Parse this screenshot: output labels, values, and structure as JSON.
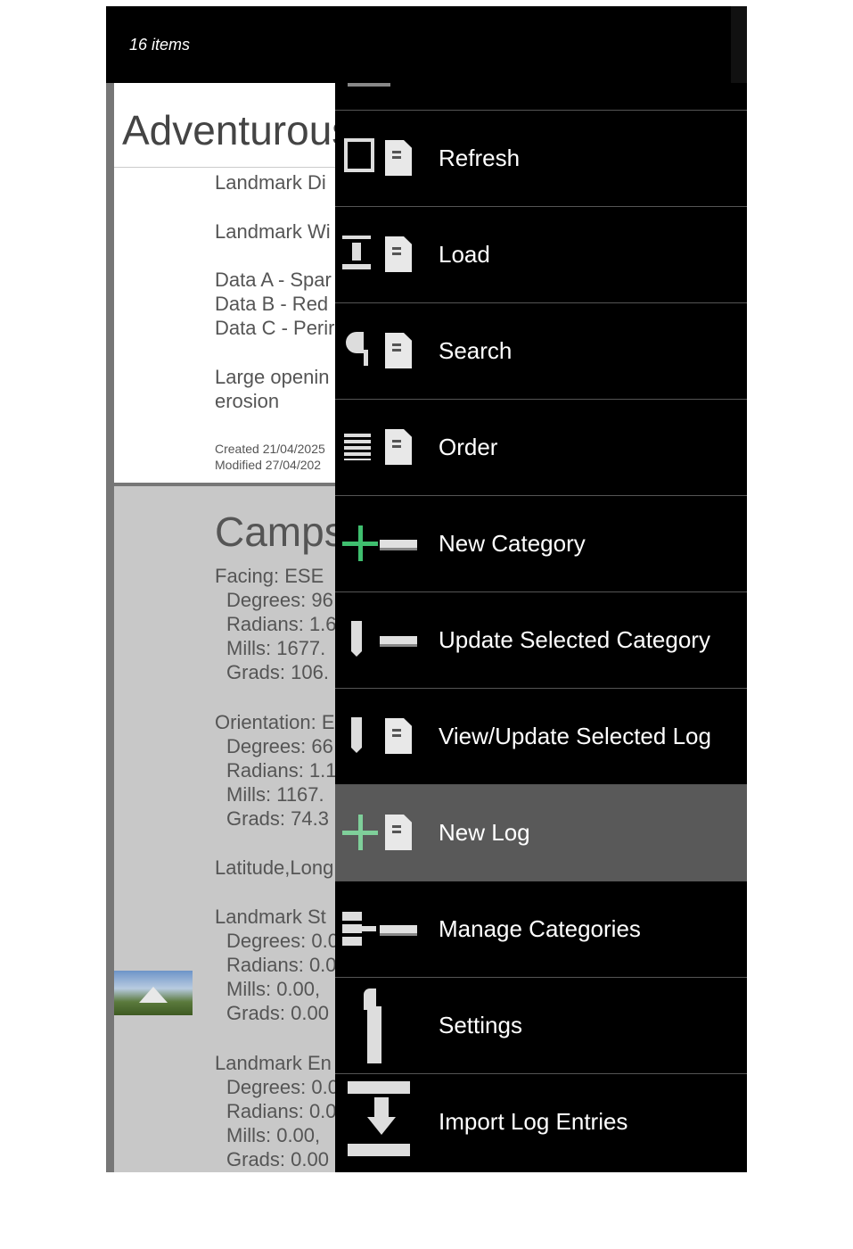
{
  "topbar": {
    "item_count": "16 items"
  },
  "cards": [
    {
      "title": "Adventurous",
      "lines": [
        "Landmark Di",
        "Landmark Wi",
        "Data A - Spar",
        "Data B - Red",
        "Data C - Perir",
        "Large openin",
        "erosion"
      ],
      "created": "Created 21/04/2025",
      "modified": "Modified 27/04/202"
    },
    {
      "title": "Camps",
      "lines": [
        "Facing: ESE",
        "Degrees: 96",
        "Radians: 1.6",
        "Mills: 1677.",
        "Grads: 106.",
        "Orientation: E",
        "Degrees: 66",
        "Radians: 1.1",
        "Mills: 1167.",
        "Grads: 74.3",
        "Latitude,Long",
        "Landmark St",
        "Degrees: 0.0",
        "Radians: 0.0",
        "Mills: 0.00,",
        "Grads: 0.00",
        "Landmark En",
        "Degrees: 0.0",
        "Radians: 0.0",
        "Mills: 0.00,",
        "Grads: 0.00"
      ]
    }
  ],
  "menu": {
    "items": [
      {
        "label": "Refresh",
        "icon": "refresh-icon"
      },
      {
        "label": "Load",
        "icon": "load-icon"
      },
      {
        "label": "Search",
        "icon": "search-icon"
      },
      {
        "label": "Order",
        "icon": "order-icon"
      },
      {
        "label": "New Category",
        "icon": "add-category-icon"
      },
      {
        "label": "Update Selected Category",
        "icon": "edit-category-icon"
      },
      {
        "label": "View/Update Selected Log",
        "icon": "edit-log-icon"
      },
      {
        "label": "New Log",
        "icon": "add-log-icon",
        "selected": true
      },
      {
        "label": "Manage Categories",
        "icon": "manage-categories-icon"
      },
      {
        "label": "Settings",
        "icon": "settings-icon"
      },
      {
        "label": "Import Log Entries",
        "icon": "import-icon"
      }
    ]
  },
  "colors": {
    "plus_accent": "#3fbf6f",
    "selected_bg": "#595959",
    "menu_bg": "#000000"
  }
}
